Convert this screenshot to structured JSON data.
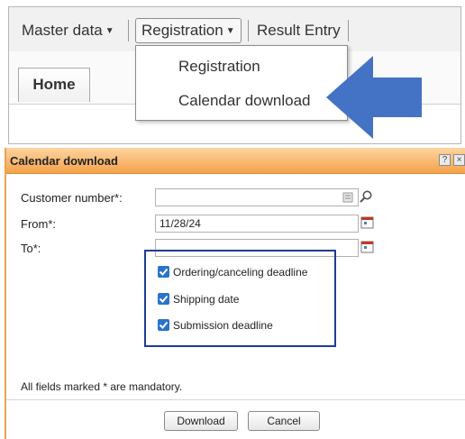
{
  "menu": {
    "master_data": "Master data",
    "registration": "Registration",
    "result_entry": "Result Entry"
  },
  "tabs": {
    "home": "Home"
  },
  "dropdown": {
    "items": [
      "Registration",
      "Calendar download"
    ]
  },
  "dialog": {
    "title": "Calendar download",
    "help_glyph": "?",
    "close_glyph": "×",
    "fields": {
      "customer_number": {
        "label": "Customer number*:",
        "value": ""
      },
      "from": {
        "label": "From*:",
        "value": "11/28/24"
      },
      "to": {
        "label": "To*:",
        "value": ""
      }
    },
    "checkboxes": [
      {
        "label": "Ordering/canceling deadline",
        "checked": true
      },
      {
        "label": "Shipping date",
        "checked": true
      },
      {
        "label": "Submission deadline",
        "checked": true
      }
    ],
    "mandatory_note": "All fields marked * are mandatory.",
    "download_label": "Download",
    "cancel_label": "Cancel"
  },
  "colors": {
    "arrow": "#4472c4",
    "titlebar": "#f4a24a",
    "highlight_border": "#1f3c93",
    "checkbox": "#2a73c8"
  },
  "icons": [
    "caret-down-icon",
    "blue-arrow-icon",
    "help-icon",
    "close-icon",
    "search-icon",
    "calendar-icon",
    "checkmark-icon"
  ]
}
